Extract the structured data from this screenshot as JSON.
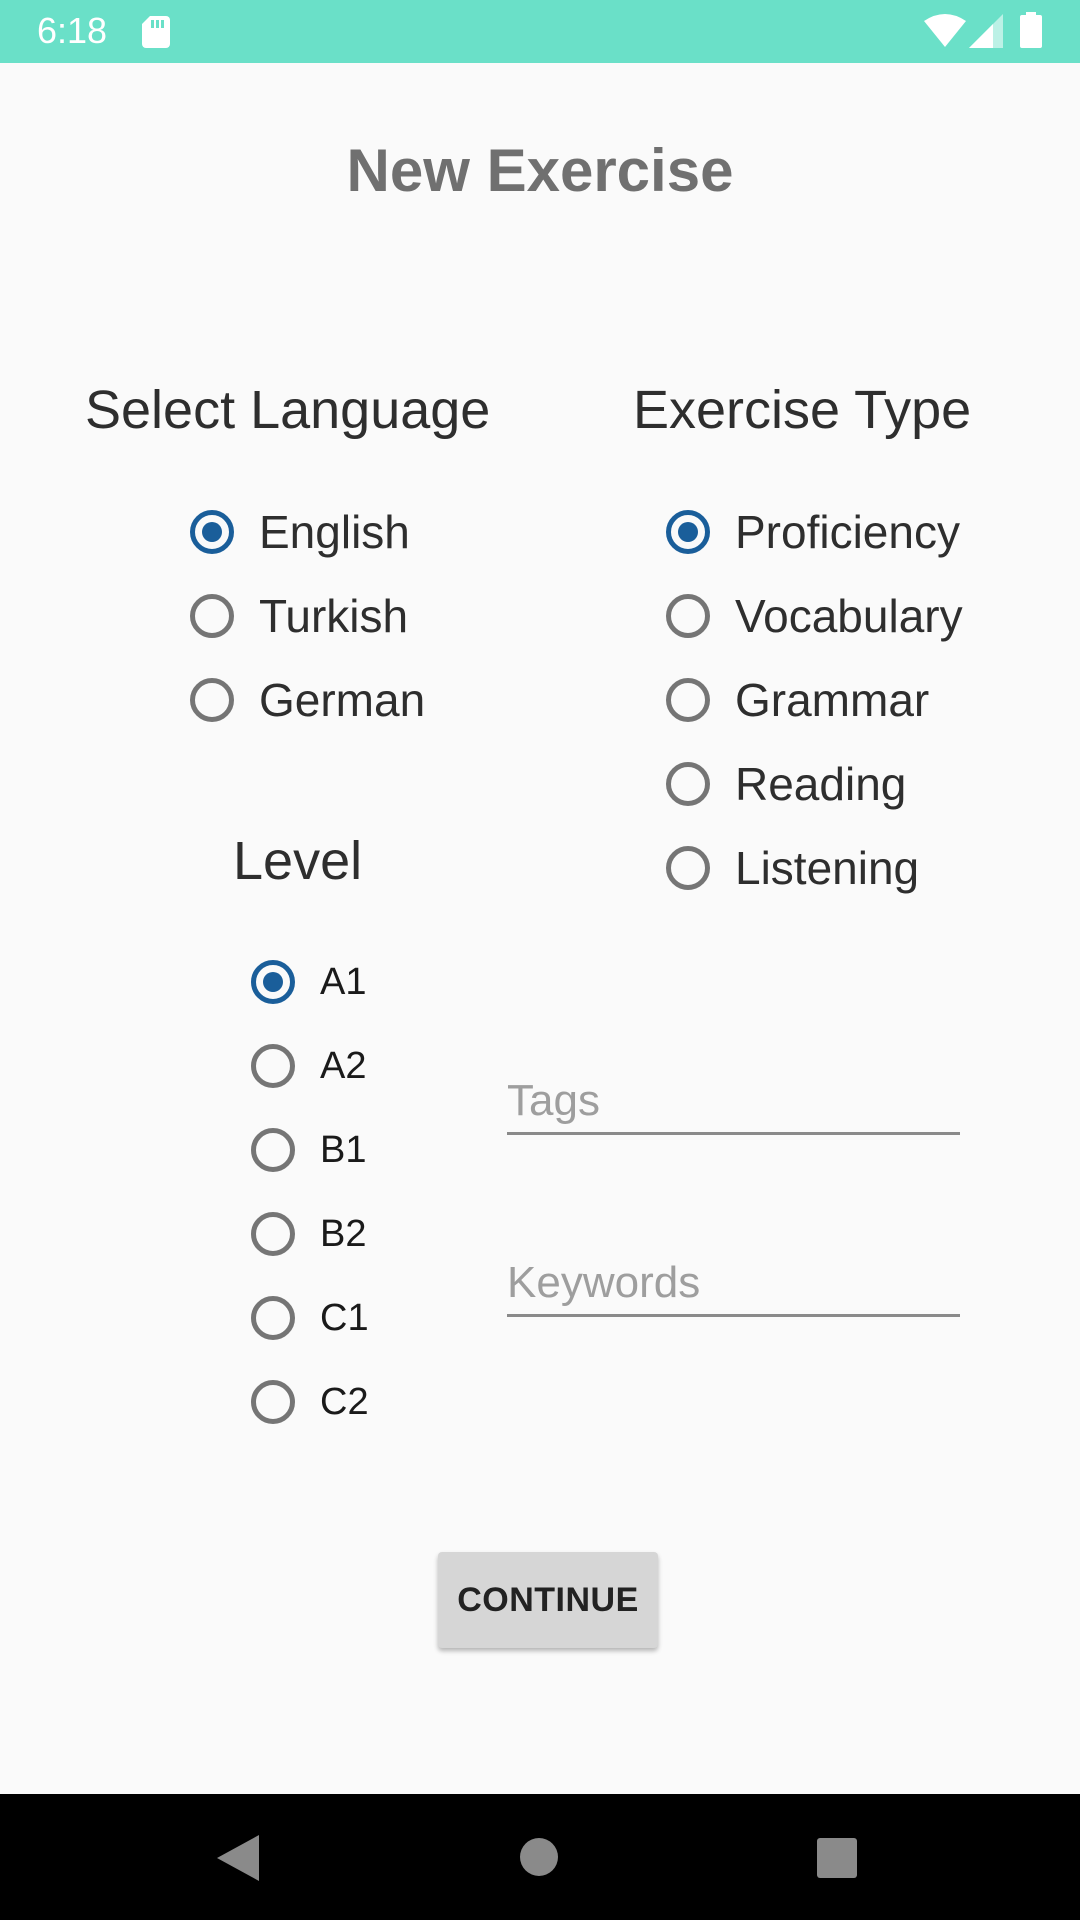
{
  "status_bar": {
    "time": "6:18",
    "background": "#6ae0c8",
    "icons": [
      "sd-card-icon",
      "wifi-icon",
      "signal-icon",
      "battery-icon"
    ]
  },
  "page": {
    "title": "New Exercise"
  },
  "language": {
    "heading": "Select Language",
    "options": [
      {
        "label": "English",
        "checked": true
      },
      {
        "label": "Turkish",
        "checked": false
      },
      {
        "label": "German",
        "checked": false
      }
    ]
  },
  "exercise_type": {
    "heading": "Exercise Type",
    "options": [
      {
        "label": "Proficiency",
        "checked": true
      },
      {
        "label": "Vocabulary",
        "checked": false
      },
      {
        "label": "Grammar",
        "checked": false
      },
      {
        "label": "Reading",
        "checked": false
      },
      {
        "label": "Listening",
        "checked": false
      }
    ]
  },
  "level": {
    "heading": "Level",
    "options": [
      {
        "label": "A1",
        "checked": true
      },
      {
        "label": "A2",
        "checked": false
      },
      {
        "label": "B1",
        "checked": false
      },
      {
        "label": "B2",
        "checked": false
      },
      {
        "label": "C1",
        "checked": false
      },
      {
        "label": "C2",
        "checked": false
      }
    ]
  },
  "fields": {
    "tags": {
      "value": "",
      "placeholder": "Tags"
    },
    "keywords": {
      "value": "",
      "placeholder": "Keywords"
    }
  },
  "actions": {
    "continue_label": "CONTINUE"
  },
  "nav_bar": {
    "icons": [
      "back-icon",
      "home-icon",
      "recents-icon"
    ]
  },
  "colors": {
    "accent": "#1a5e9a",
    "title": "#707070",
    "background": "#fafafa",
    "button": "#d6d6d6"
  }
}
